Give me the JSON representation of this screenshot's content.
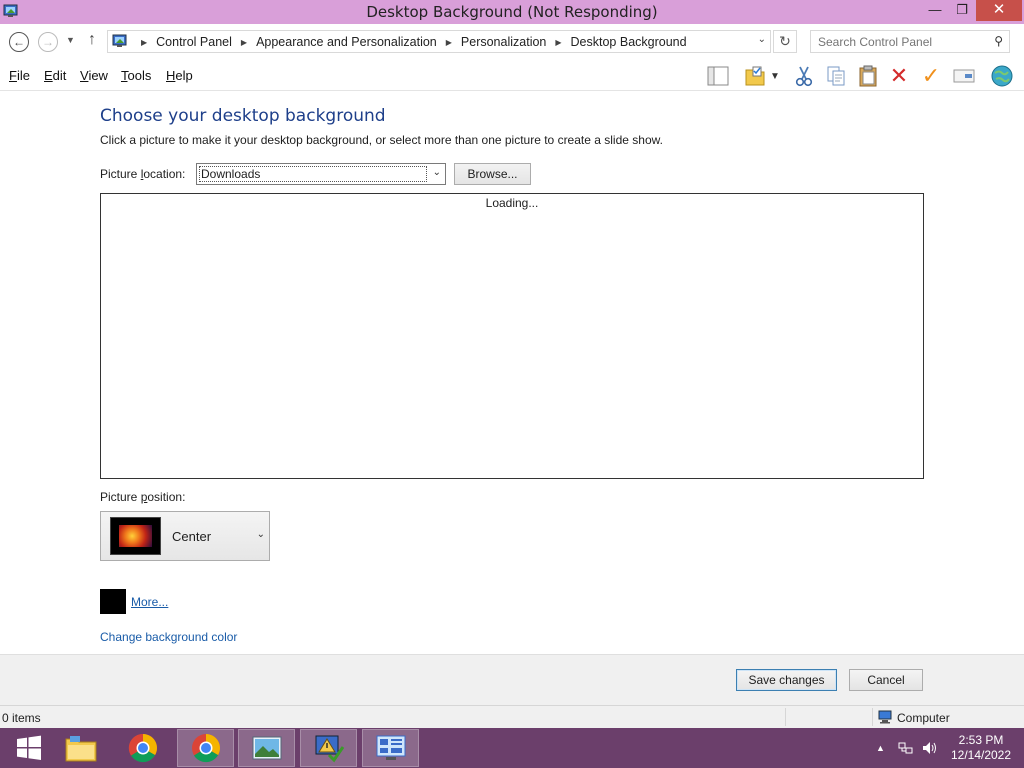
{
  "window": {
    "title": "Desktop Background (Not Responding)",
    "min_label": "—",
    "max_label": "❐",
    "close_label": "✕"
  },
  "address_bar": {
    "breadcrumbs": [
      "Control Panel",
      "Appearance and Personalization",
      "Personalization",
      "Desktop Background"
    ],
    "search_placeholder": "Search Control Panel"
  },
  "menu": {
    "items": [
      {
        "label": "File",
        "accel": "F",
        "rest": "ile"
      },
      {
        "label": "Edit",
        "accel": "E",
        "rest": "dit"
      },
      {
        "label": "View",
        "accel": "V",
        "rest": "iew"
      },
      {
        "label": "Tools",
        "accel": "T",
        "rest": "ools"
      },
      {
        "label": "Help",
        "accel": "H",
        "rest": "elp"
      }
    ]
  },
  "toolbar_icons": [
    "layout-icon",
    "folder-properties-icon",
    "dropdown-icon",
    "cut-icon",
    "copy-icon",
    "paste-icon",
    "delete-icon",
    "check-icon",
    "rename-icon",
    "globe-icon"
  ],
  "page": {
    "heading": "Choose your desktop background",
    "subtext": "Click a picture to make it your desktop background, or select more than one picture to create a slide show.",
    "location_label_pre": "Picture ",
    "location_label_accel": "l",
    "location_label_post": "ocation:",
    "location_value": "Downloads",
    "browse_label": "Browse...",
    "loading_text": "Loading...",
    "position_label_pre": "Picture ",
    "position_label_accel": "p",
    "position_label_post": "osition:",
    "position_value": "Center",
    "more_link": "More...",
    "change_color_link": "Change background color",
    "swatch_color": "#000000"
  },
  "buttons": {
    "save": "Save changes",
    "cancel": "Cancel"
  },
  "status": {
    "items": "0 items",
    "location": "Computer"
  },
  "taskbar": {
    "apps": [
      "start-icon",
      "file-explorer-icon",
      "chrome-icon",
      "chrome-icon",
      "photo-viewer-icon",
      "action-center-icon",
      "control-panel-icon"
    ],
    "time": "2:53 PM",
    "date": "12/14/2022"
  },
  "colors": {
    "titlebar": "#d99fd9",
    "taskbar": "#6b3f6b",
    "heading": "#1e3f8a",
    "link": "#1a5ca8"
  }
}
